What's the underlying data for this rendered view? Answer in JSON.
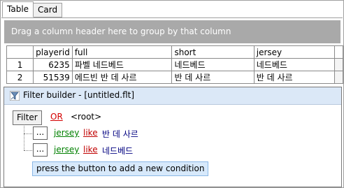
{
  "tabs": [
    {
      "label": "Table",
      "active": true
    },
    {
      "label": "Card",
      "active": false
    }
  ],
  "group_panel": {
    "text": "Drag a column header here to group by that column"
  },
  "grid": {
    "columns": [
      "",
      "playerid",
      "full",
      "short",
      "jersey"
    ],
    "rows": [
      {
        "row_no": "1",
        "playerid": "6235",
        "full": "파벨 네드베드",
        "short": "네드베드",
        "jersey": "네드베드"
      },
      {
        "row_no": "2",
        "playerid": "51539",
        "full": "에드빈 반 데 사르",
        "short": "반 데 사르",
        "jersey": "반 데 사르"
      }
    ]
  },
  "filter_builder": {
    "title": "Filter builder - [untitled.flt]",
    "filter_button": "Filter",
    "root_operator": "OR",
    "root_label": "<root>",
    "conditions": [
      {
        "button": "...",
        "field": "jersey",
        "operator": "like",
        "value": "반 데 사르"
      },
      {
        "button": "...",
        "field": "jersey",
        "operator": "like",
        "value": "네드베드"
      }
    ],
    "add_condition_text": "press the button to add a new condition"
  },
  "colors": {
    "group_panel_bg": "#a9a9a9",
    "title_bar_bg": "#dbe8f7",
    "field_color": "#008000",
    "operator_color": "#c00000",
    "value_color": "#000080",
    "add_condition_bg": "#d7e9fb"
  },
  "icons": {
    "title_icon": "filter-funnel-icon"
  }
}
